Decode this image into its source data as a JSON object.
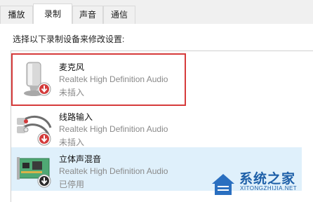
{
  "tabs": [
    {
      "label": "播放"
    },
    {
      "label": "录制"
    },
    {
      "label": "声音"
    },
    {
      "label": "通信"
    }
  ],
  "instruction": "选择以下录制设备来修改设置:",
  "devices": [
    {
      "name": "麦克风",
      "description": "Realtek High Definition Audio",
      "status": "未插入",
      "icon": "microphone-icon",
      "badge": "unplugged-badge"
    },
    {
      "name": "线路输入",
      "description": "Realtek High Definition Audio",
      "status": "未插入",
      "icon": "line-in-cable-icon",
      "badge": "unplugged-badge"
    },
    {
      "name": "立体声混音",
      "description": "Realtek High Definition Audio",
      "status": "已停用",
      "icon": "sound-card-icon",
      "badge": "disabled-badge"
    }
  ],
  "watermark": {
    "title": "系统之家",
    "subtitle": "XITONGZHIJIA.NET"
  },
  "colors": {
    "highlight_border": "#d63b3b",
    "selected_row": "#dff0fb",
    "watermark": "#1d5fa8"
  }
}
